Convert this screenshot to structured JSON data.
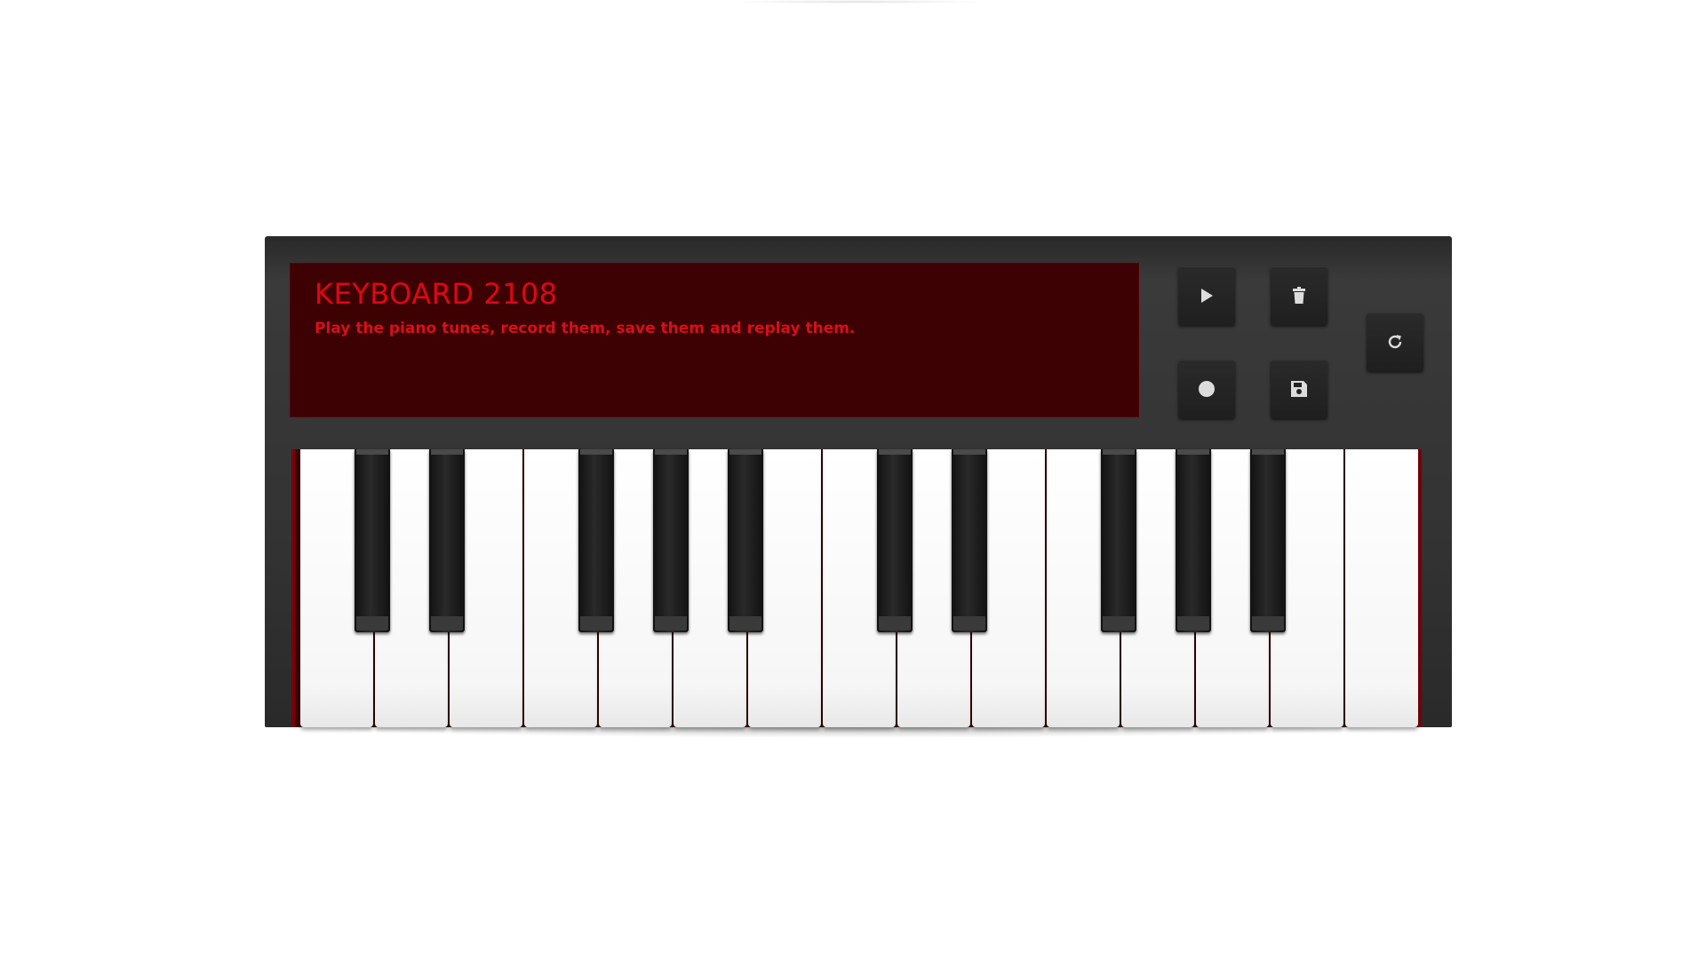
{
  "display": {
    "title": "KEYBOARD 2108",
    "description": "Play the piano tunes, record them, save them and replay them."
  },
  "controls": {
    "play": {
      "icon": "play-icon"
    },
    "delete": {
      "icon": "trash-icon"
    },
    "record": {
      "icon": "record-icon"
    },
    "save": {
      "icon": "floppy-disk-icon"
    },
    "reset": {
      "icon": "refresh-icon"
    }
  },
  "keys": {
    "white_count": 15,
    "black_count": 10
  },
  "colors": {
    "display_background": "#3d0003",
    "display_text": "#e00614",
    "body": "#333333"
  }
}
